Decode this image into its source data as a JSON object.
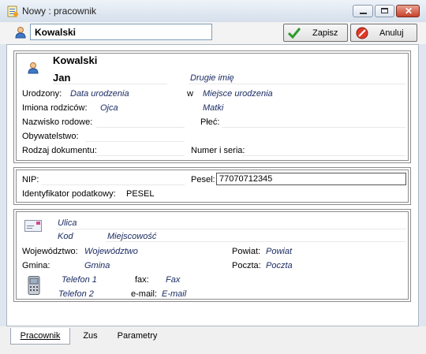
{
  "window": {
    "title": "Nowy : pracownik"
  },
  "toolbar": {
    "name_value": "Kowalski",
    "save_label": "Zapisz",
    "cancel_label": "Anuluj"
  },
  "person": {
    "surname": "Kowalski",
    "first_name": "Jan",
    "second_name_placeholder": "Drugie imię",
    "born_label": "Urodzony:",
    "birth_date_placeholder": "Data urodzenia",
    "born_in_label": "w",
    "birth_place_placeholder": "Miejsce urodzenia",
    "parents_label": "Imiona rodziców:",
    "father_placeholder": "Ojca",
    "mother_placeholder": "Matki",
    "family_name_label": "Nazwisko rodowe:",
    "gender_label": "Płeć:",
    "citizenship_label": "Obywatelstwo:",
    "document_type_label": "Rodzaj dokumentu:",
    "document_number_label": "Numer i seria:"
  },
  "tax": {
    "nip_label": "NIP:",
    "pesel_label": "Pesel:",
    "pesel_value": "77070712345",
    "tax_id_label": "Identyfikator podatkowy:",
    "tax_id_value": "PESEL"
  },
  "address": {
    "street_placeholder": "Ulica",
    "postcode_placeholder": "Kod",
    "city_placeholder": "Miejscowość",
    "voivodeship_label": "Województwo:",
    "voivodeship_placeholder": "Województwo",
    "county_label": "Powiat:",
    "county_placeholder": "Powiat",
    "commune_label": "Gmina:",
    "commune_placeholder": "Gmina",
    "post_label": "Poczta:",
    "post_placeholder": "Poczta",
    "phone1_placeholder": "Telefon 1",
    "fax_label": "fax:",
    "fax_placeholder": "Fax",
    "phone2_placeholder": "Telefon 2",
    "email_label": "e-mail:",
    "email_placeholder": "E-mail"
  },
  "tabs": [
    {
      "label": "Pracownik"
    },
    {
      "label": "Zus"
    },
    {
      "label": "Parametry"
    }
  ]
}
